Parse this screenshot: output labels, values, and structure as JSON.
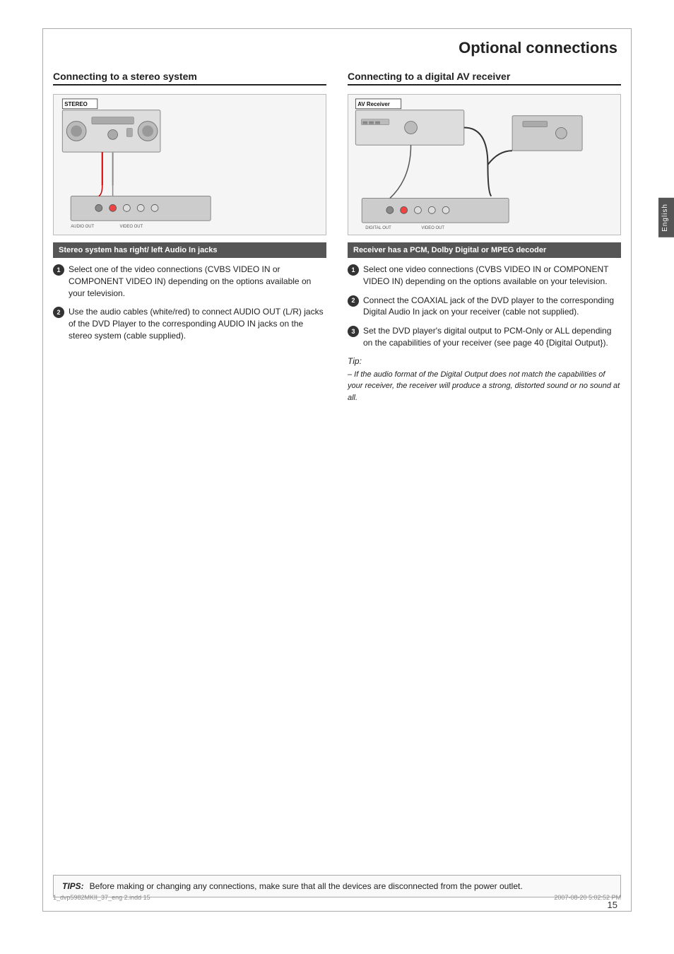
{
  "page": {
    "title": "Optional connections",
    "page_number": "15",
    "english_tab": "English"
  },
  "footer": {
    "left": "1_dvp5982MKII_37_eng 2.indd   15",
    "right": "2007-08-20   5:02:52 PM"
  },
  "tips_box": {
    "label": "TIPS:",
    "text": "Before making or changing any connections, make sure that all the devices are disconnected from the power outlet."
  },
  "left_column": {
    "section_title": "Connecting to a stereo system",
    "sub_header": "Stereo system has right/ left Audio In jacks",
    "diagram_label": "STEREO",
    "steps": [
      {
        "num": "1",
        "text": "Select one of the video connections (CVBS VIDEO IN or COMPONENT VIDEO IN) depending on the options available on your television."
      },
      {
        "num": "2",
        "text": "Use the audio cables (white/red) to connect AUDIO OUT (L/R) jacks of the DVD Player to the corresponding AUDIO IN jacks on the stereo system (cable supplied)."
      }
    ]
  },
  "right_column": {
    "section_title": "Connecting to a digital AV receiver",
    "sub_header": "Receiver has a PCM, Dolby Digital or MPEG decoder",
    "diagram_label": "AV Receiver",
    "steps": [
      {
        "num": "1",
        "text": "Select one video connections (CVBS VIDEO IN or COMPONENT VIDEO IN) depending on the options available on your television."
      },
      {
        "num": "2",
        "text": "Connect the COAXIAL jack of the DVD player to the corresponding Digital Audio In jack on your receiver (cable not supplied)."
      },
      {
        "num": "3",
        "text": "Set the DVD player's digital output to PCM-Only or ALL depending on the capabilities of your receiver (see page 40 {Digital Output})."
      }
    ],
    "tip": {
      "label": "Tip:",
      "text": "– If the audio format of the Digital Output does not match the capabilities of your receiver, the receiver will produce a strong, distorted sound or no sound at all."
    }
  }
}
